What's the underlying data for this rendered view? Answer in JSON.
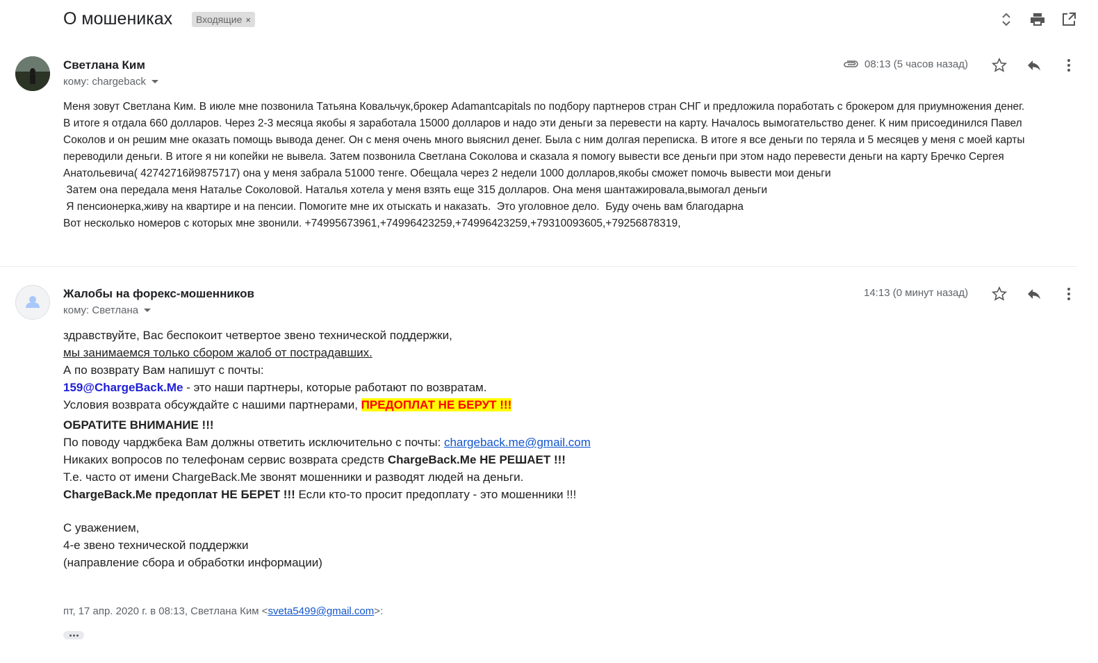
{
  "thread": {
    "subject": "О мошениках",
    "label": "Входящие",
    "label_remove": "×"
  },
  "toolbar": {
    "icons": [
      "expand-collapse-icon",
      "print-icon",
      "open-in-new-window-icon"
    ]
  },
  "messages": [
    {
      "sender": "Светлана Ким",
      "to": "кому: chargeback",
      "time": "08:13 (5 часов назад)",
      "has_attachment": true,
      "body": [
        "Меня зовут Светлана Ким. В июле мне позвонила Татьяна Ковальчук,брокер Adamantcapitals по подбору партнеров стран СНГ и предложила поработать с брокером для приумножения денег.",
        "В итоге я отдала 660 долларов. Через 2-3 месяца якобы я заработала 15000 долларов и надо эти деньги за перевести на карту.  Началось вымогательство денег. К ним присоединился Павел",
        "Соколов и он решим мне оказать помощь вывода денег. Он с меня очень много выяснил денег. Была с ним долгая переписка.  В итоге я все деньги по теряла и 5 месяцев у меня с моей карты",
        "переводили деньги. В итоге я ни копейки не вывела. Затем позвонила Светлана Соколова и сказала я помогу вывести все деньги при этом надо перевести деньги на карту Бречко Сергея",
        "Анатольевича( 42742716й9875717) она у меня забрала 51000 тенге. Обещала через 2 недели  1000 долларов,якобы сможет помочь вывести мои деньги",
        " Затем она передала меня Наталье Соколовой. Наталья хотела у меня взять еще 315 долларов. Она меня шантажировала,вымогал деньги",
        " Я пенсионерка,живу на квартире и на пенсии. Помогите мне их отыскать и наказать.  Это уголовное дело.  Буду очень вам благодарна",
        "Вот несколько номеров с которых мне звонили. +74995673961,+74996423259,+74996423259,+79310093605,+79256878319,"
      ]
    },
    {
      "sender": "Жалобы на форекс-мошенников",
      "to": "кому: Светлана",
      "time": "14:13 (0 минут назад)",
      "body": {
        "l1": "здравствуйте, Вас беспокоит четвертое звено технической поддержки,",
        "l2": "мы занимаемся только сбором жалоб от пострадавших.",
        "l3": "А по возврату Вам напишут с почты:",
        "l4_email": "159@ChargeBack.Me",
        "l4_rest": " - это наши партнеры, которые работают по возвратам.",
        "l5_text": "Условия возврата обсуждайте с нашими партнерами, ",
        "l5_highlight": "ПРЕДОПЛАТ НЕ БЕРУТ !!!",
        "l6": "ОБРАТИТЕ ВНИМАНИЕ !!!",
        "l7_text": "По поводу чарджбека Вам должны ответить исключительно с почты: ",
        "l7_link": "chargeback.me@gmail.com",
        "l8_text": "Никаких вопросов по телефонам сервис возврата средств ",
        "l8_bold": "ChargeBack.Me НЕ РЕШАЕТ !!!",
        "l9": "Т.е. часто от имени ChargeBack.Me звонят мошенники и разводят людей на деньги.",
        "l10_bold": "ChargeBack.Me предоплат НЕ БЕРЕТ !!!",
        "l10_rest": " Если кто-то просит предоплату - это мошенники !!!",
        "sig1": "С уважением,",
        "sig2": "4-е звено технической поддержки",
        "sig3": "(направление сбора и обработки информации)"
      },
      "quote": {
        "prefix": "пт, 17 апр. 2020 г. в 08:13, Светлана Ким <",
        "email": "sveta5499@gmail.com",
        "suffix": ">:"
      }
    }
  ]
}
